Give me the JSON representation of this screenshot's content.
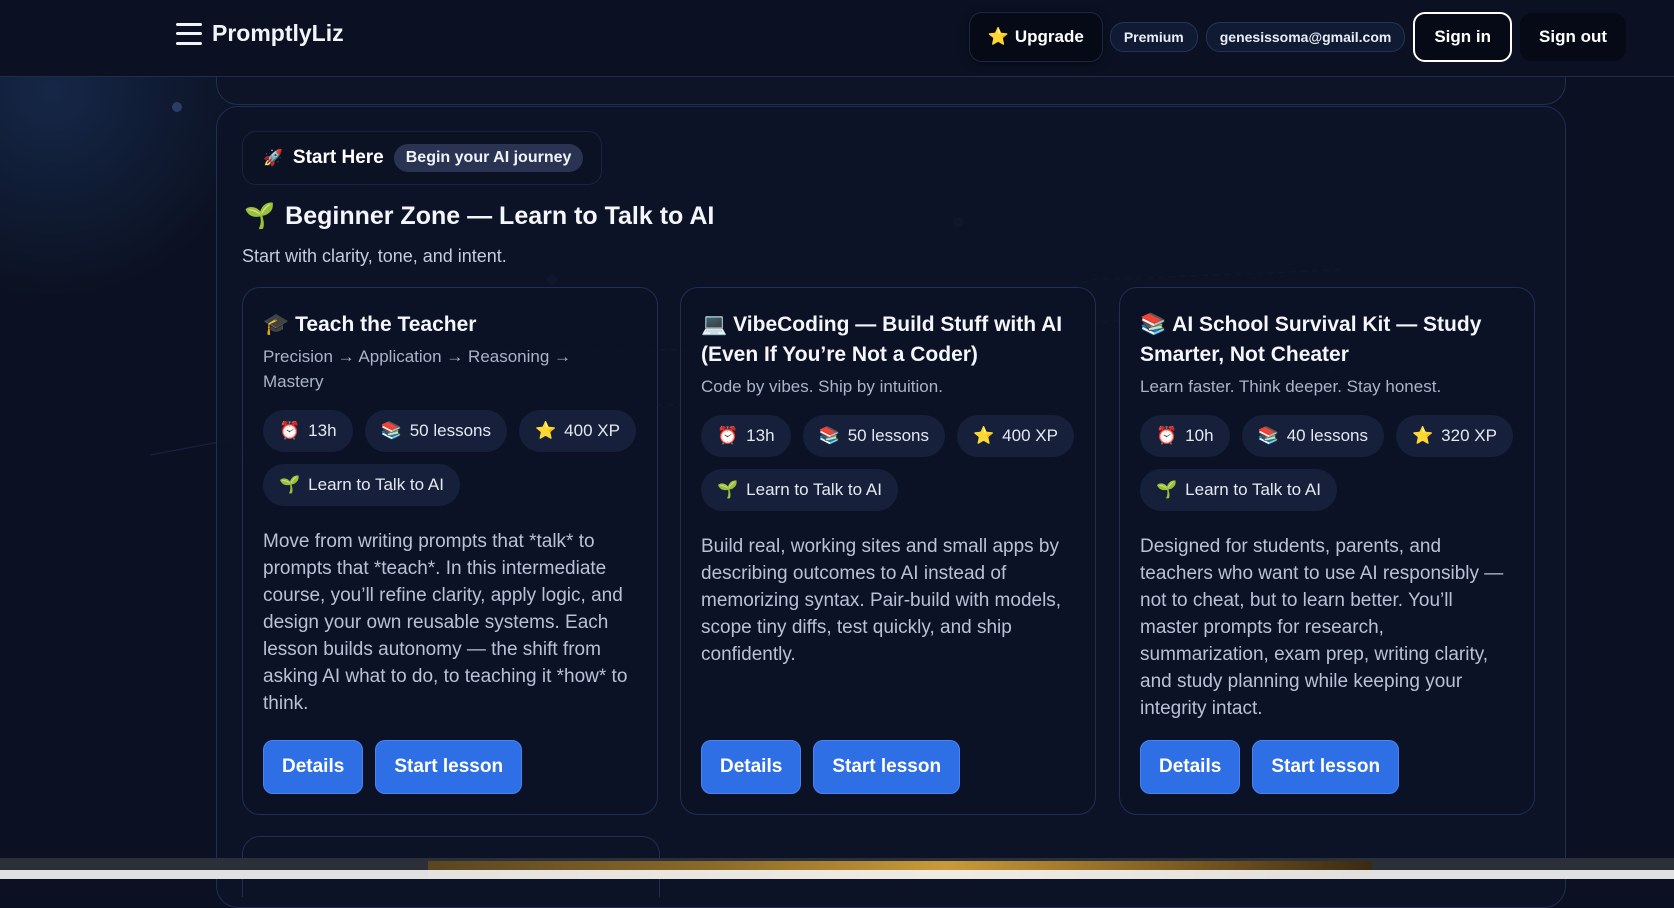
{
  "header": {
    "brand": "PromptlyLiz",
    "upgrade_icon": "⭐",
    "upgrade_label": "Upgrade",
    "premium_label": "Premium",
    "email": "genesissoma@gmail.com",
    "sign_in_label": "Sign in",
    "sign_out_label": "Sign out"
  },
  "section": {
    "chip_icon": "🚀",
    "chip_title": "Start Here",
    "chip_subtitle": "Begin your AI journey",
    "zone_icon": "🌱",
    "zone_title": "Beginner Zone — Learn to Talk to AI",
    "zone_subtitle": "Start with clarity, tone, and intent."
  },
  "cards": [
    {
      "icon": "🎓",
      "title": "Teach the Teacher",
      "subtitle": "Precision → Application → Reasoning → Mastery",
      "stats": [
        {
          "icon": "⏰",
          "text": "13h"
        },
        {
          "icon": "📚",
          "text": "50 lessons"
        },
        {
          "icon": "⭐",
          "text": "400 XP"
        }
      ],
      "tag": {
        "icon": "🌱",
        "text": "Learn to Talk to AI"
      },
      "description": "Move from writing prompts that *talk* to prompts that *teach*. In this intermediate course, you’ll refine clarity, apply logic, and design your own reusable systems. Each lesson builds autonomy — the shift from asking AI what to do, to teaching it *how* to think.",
      "details_label": "Details",
      "start_label": "Start lesson"
    },
    {
      "icon": "💻",
      "title": "VibeCoding — Build Stuff with AI (Even If You’re Not a Coder)",
      "subtitle": "Code by vibes. Ship by intuition.",
      "stats": [
        {
          "icon": "⏰",
          "text": "13h"
        },
        {
          "icon": "📚",
          "text": "50 lessons"
        },
        {
          "icon": "⭐",
          "text": "400 XP"
        }
      ],
      "tag": {
        "icon": "🌱",
        "text": "Learn to Talk to AI"
      },
      "description": "Build real, working sites and small apps by describing outcomes to AI instead of memorizing syntax. Pair-build with models, scope tiny diffs, test quickly, and ship confidently.",
      "details_label": "Details",
      "start_label": "Start lesson"
    },
    {
      "icon": "📚",
      "title": "AI School Survival Kit — Study Smarter, Not Cheater",
      "subtitle": "Learn faster. Think deeper. Stay honest.",
      "stats": [
        {
          "icon": "⏰",
          "text": "10h"
        },
        {
          "icon": "📚",
          "text": "40 lessons"
        },
        {
          "icon": "⭐",
          "text": "320 XP"
        }
      ],
      "tag": {
        "icon": "🌱",
        "text": "Learn to Talk to AI"
      },
      "description": "Designed for students, parents, and teachers who want to use AI responsibly — not to cheat, but to learn better. You’ll master prompts for research, summarization, exam prep, writing clarity, and study planning while keeping your integrity intact.",
      "details_label": "Details",
      "start_label": "Start lesson"
    }
  ]
}
